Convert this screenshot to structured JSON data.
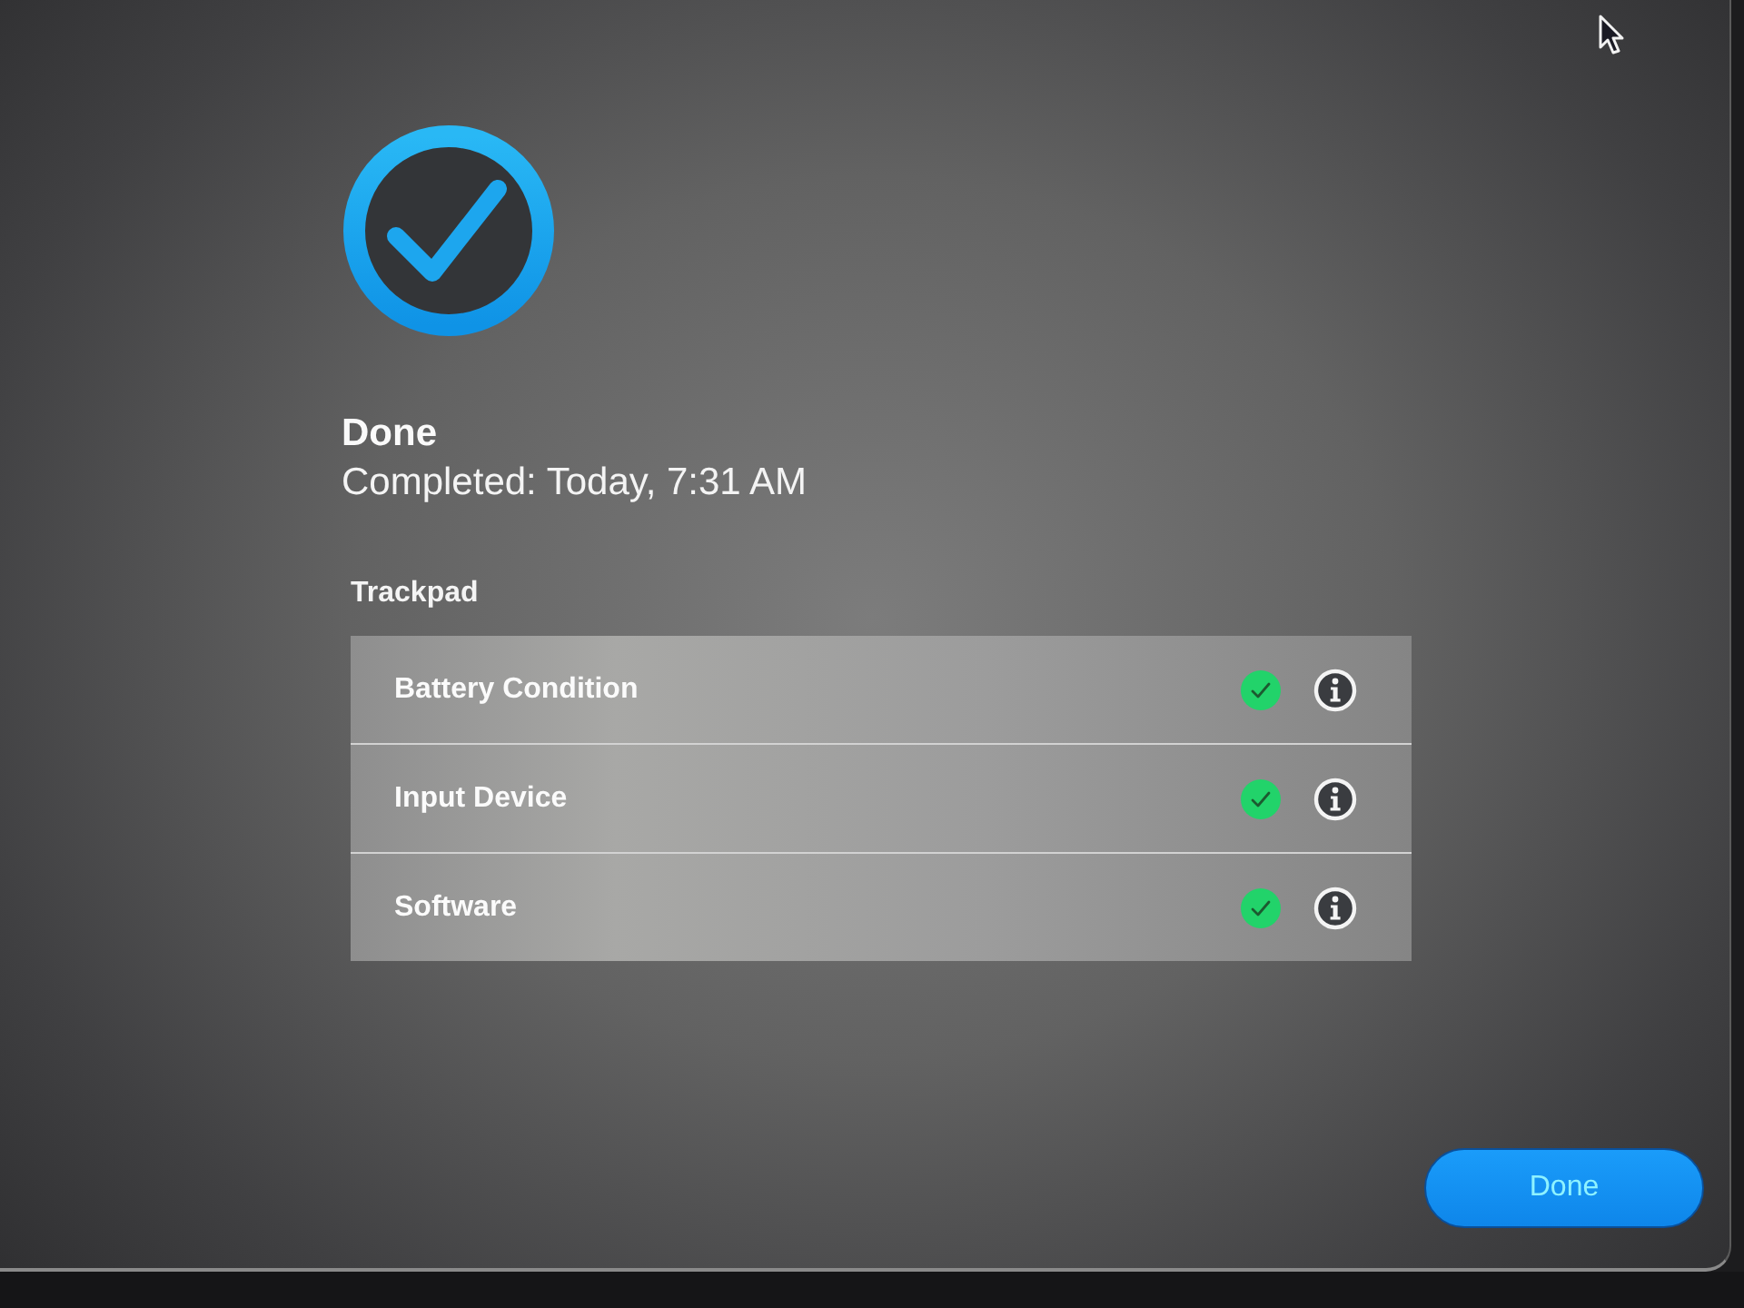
{
  "header": {
    "title": "Done",
    "subtitle": "Completed: Today, 7:31 AM"
  },
  "section": {
    "title": "Trackpad",
    "items": [
      {
        "label": "Battery Condition",
        "passed": true
      },
      {
        "label": "Input Device",
        "passed": true
      },
      {
        "label": "Software",
        "passed": true
      }
    ]
  },
  "buttons": [
    {
      "label": "Done",
      "kind": "primary"
    }
  ]
}
